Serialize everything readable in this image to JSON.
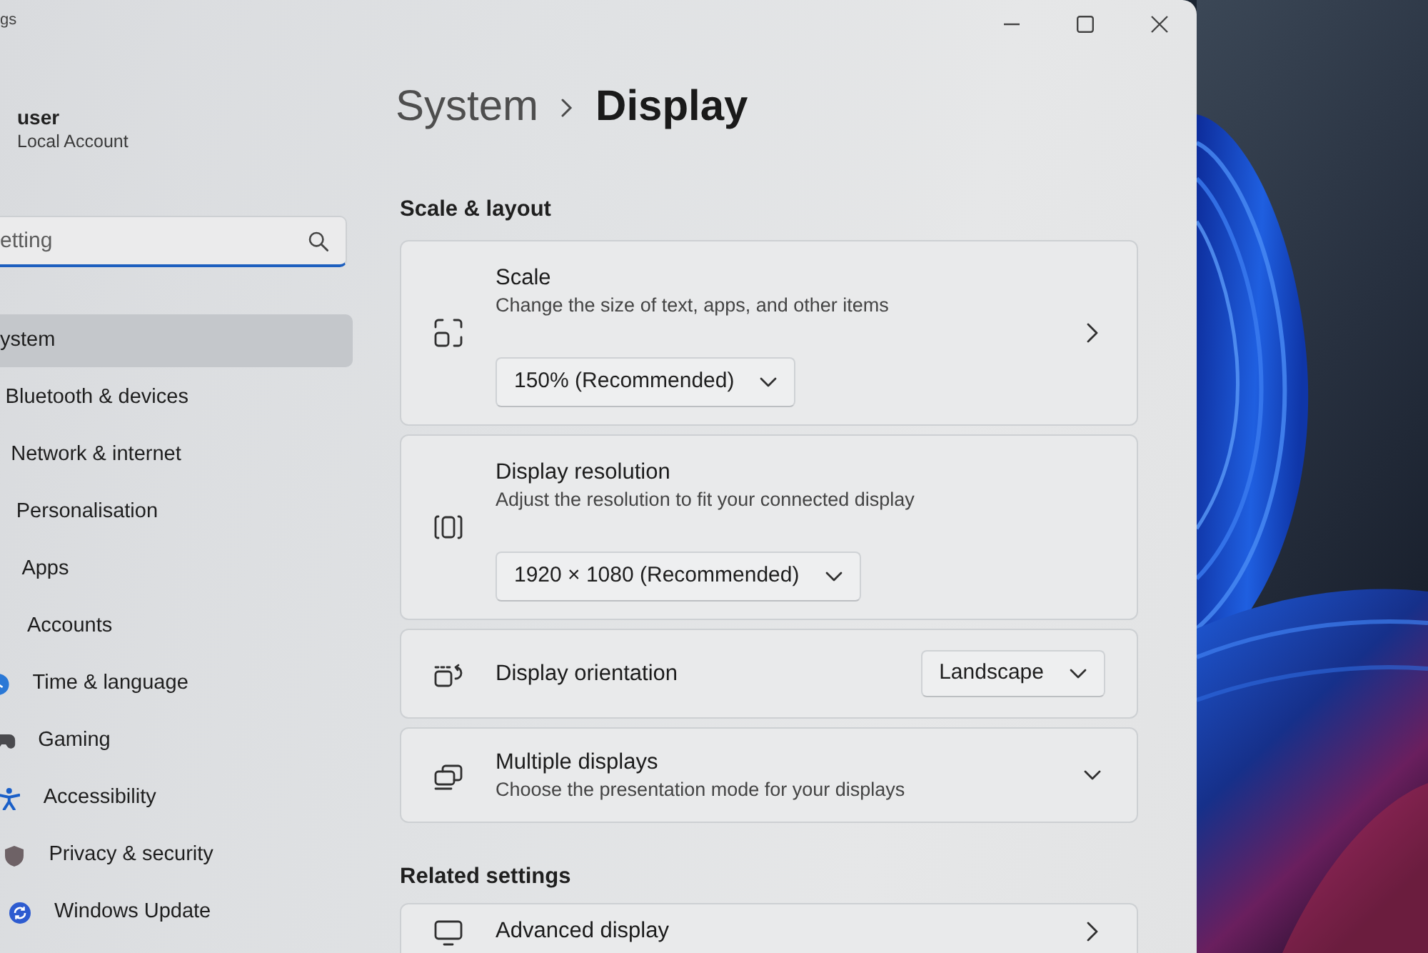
{
  "window": {
    "title": "gs"
  },
  "account": {
    "name": "user",
    "type": "Local Account"
  },
  "search": {
    "placeholder": "etting"
  },
  "sidebar": {
    "items": [
      {
        "label": "ystem",
        "selected": true
      },
      {
        "label": "Bluetooth & devices",
        "selected": false
      },
      {
        "label": "Network & internet",
        "selected": false
      },
      {
        "label": "Personalisation",
        "selected": false
      },
      {
        "label": "Apps",
        "selected": false
      },
      {
        "label": "Accounts",
        "selected": false
      },
      {
        "label": "Time & language",
        "selected": false
      },
      {
        "label": "Gaming",
        "selected": false
      },
      {
        "label": "Accessibility",
        "selected": false
      },
      {
        "label": "Privacy & security",
        "selected": false
      },
      {
        "label": "Windows Update",
        "selected": false
      }
    ]
  },
  "breadcrumb": {
    "parent": "System",
    "current": "Display"
  },
  "sections": [
    {
      "title": "Scale & layout",
      "cards": [
        {
          "kind": "stacked",
          "title": "Scale",
          "description": "Change the size of text, apps, and other items",
          "value": "150% (Recommended)",
          "opens_page": true
        },
        {
          "kind": "stacked",
          "title": "Display resolution",
          "description": "Adjust the resolution to fit your connected display",
          "value": "1920 × 1080 (Recommended)",
          "opens_page": false
        },
        {
          "kind": "inline",
          "title": "Display orientation",
          "value": "Landscape"
        },
        {
          "kind": "expander",
          "title": "Multiple displays",
          "description": "Choose the presentation mode for your displays",
          "expanded": false
        }
      ]
    },
    {
      "title": "Related settings",
      "cards": [
        {
          "kind": "link",
          "title": "Advanced display"
        }
      ]
    }
  ]
}
